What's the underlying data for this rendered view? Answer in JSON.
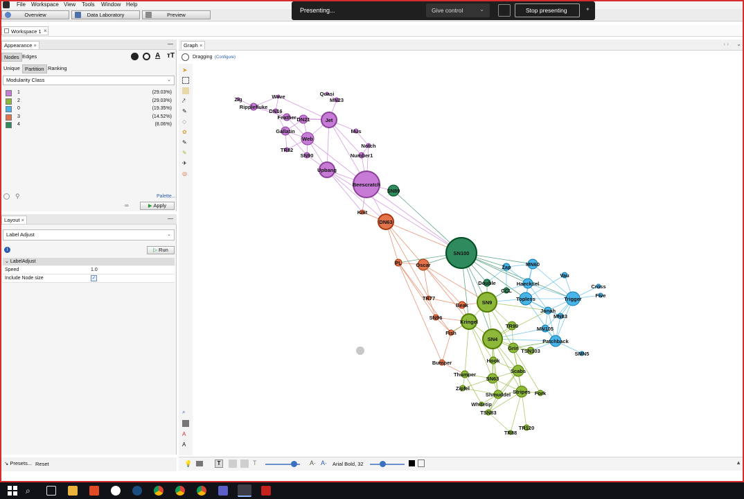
{
  "menubar": {
    "items": [
      "File",
      "Workspace",
      "View",
      "Tools",
      "Window",
      "Help"
    ]
  },
  "modes": {
    "overview": "Overview",
    "data_laboratory": "Data Laboratory",
    "preview": "Preview"
  },
  "presenting": {
    "status": "Presenting...",
    "give_control": "Give control",
    "stop": "Stop presenting"
  },
  "workspace_tab": "Workspace 1",
  "appearance": {
    "title": "Appearance",
    "tabs": [
      "Nodes",
      "Edges"
    ],
    "subtabs": [
      "Unique",
      "Partition",
      "Ranking"
    ],
    "attribute": "Modularity Class",
    "legend": [
      {
        "label": "1",
        "pct": "(29.03%)",
        "color": "#c77bd6"
      },
      {
        "label": "2",
        "pct": "(29.03%)",
        "color": "#8db83a"
      },
      {
        "label": "0",
        "pct": "(19.35%)",
        "color": "#49b4e8"
      },
      {
        "label": "3",
        "pct": "(14.52%)",
        "color": "#e3734a"
      },
      {
        "label": "4",
        "pct": "(8.06%)",
        "color": "#2f8a5e"
      }
    ],
    "palette_link": "Palette...",
    "apply": "Apply"
  },
  "layout": {
    "title": "Layout",
    "algorithm": "Label Adjust",
    "run": "Run",
    "section": "LabelAdjust",
    "props": [
      {
        "name": "Speed",
        "value": "1.0"
      },
      {
        "name": "Include Node size",
        "value": ""
      }
    ],
    "presets": "Presets...",
    "reset": "Reset"
  },
  "graph": {
    "tab": "Graph",
    "mode": "Dragging",
    "configure": "(Configure)",
    "font_label": "Arial Bold, 32"
  },
  "network": {
    "colors": {
      "1": "#c77bd6",
      "2": "#8db83a",
      "0": "#49b4e8",
      "3": "#e3734a",
      "4": "#2f8a5e"
    },
    "nodes": [
      {
        "id": "Zig",
        "g": "1",
        "r": 2
      },
      {
        "id": "Ripplefluke",
        "g": "1",
        "r": 5
      },
      {
        "id": "Wave",
        "g": "1",
        "r": 2
      },
      {
        "id": "DN16",
        "g": "1",
        "r": 3
      },
      {
        "id": "Feather",
        "g": "1",
        "r": 5
      },
      {
        "id": "Quasi",
        "g": "1",
        "r": 2
      },
      {
        "id": "MN23",
        "g": "1",
        "r": 3
      },
      {
        "id": "DN21",
        "g": "1",
        "r": 6
      },
      {
        "id": "Jet",
        "g": "1",
        "r": 11
      },
      {
        "id": "Gallatin",
        "g": "1",
        "r": 6
      },
      {
        "id": "Mus",
        "g": "1",
        "r": 3
      },
      {
        "id": "Web",
        "g": "1",
        "r": 9
      },
      {
        "id": "Notch",
        "g": "1",
        "r": 3
      },
      {
        "id": "TR82",
        "g": "1",
        "r": 3
      },
      {
        "id": "SN90",
        "g": "1",
        "r": 4
      },
      {
        "id": "Number1",
        "g": "1",
        "r": 4
      },
      {
        "id": "Upbang",
        "g": "1",
        "r": 11
      },
      {
        "id": "Beescratch",
        "g": "1",
        "r": 19
      },
      {
        "id": "SN89",
        "g": "4",
        "r": 8
      },
      {
        "id": "Knit",
        "g": "3",
        "r": 3
      },
      {
        "id": "DN63",
        "g": "3",
        "r": 11
      },
      {
        "id": "SN100",
        "g": "4",
        "r": 22
      },
      {
        "id": "PL",
        "g": "3",
        "r": 5
      },
      {
        "id": "Oscar",
        "g": "3",
        "r": 8
      },
      {
        "id": "Zap",
        "g": "0",
        "r": 5
      },
      {
        "id": "MN60",
        "g": "0",
        "r": 7
      },
      {
        "id": "Vau",
        "g": "0",
        "r": 4
      },
      {
        "id": "Double",
        "g": "4",
        "r": 5
      },
      {
        "id": "Haecksel",
        "g": "0",
        "r": 7
      },
      {
        "id": "Cross",
        "g": "0",
        "r": 3
      },
      {
        "id": "CCL",
        "g": "4",
        "r": 4
      },
      {
        "id": "TR77",
        "g": "3",
        "r": 3
      },
      {
        "id": "Topless",
        "g": "0",
        "r": 9
      },
      {
        "id": "Trigger",
        "g": "0",
        "r": 10
      },
      {
        "id": "Five",
        "g": "0",
        "r": 3
      },
      {
        "id": "Beak",
        "g": "3",
        "r": 5
      },
      {
        "id": "SN9",
        "g": "2",
        "r": 14
      },
      {
        "id": "Jonah",
        "g": "0",
        "r": 5
      },
      {
        "id": "MN83",
        "g": "0",
        "r": 4
      },
      {
        "id": "SN96",
        "g": "3",
        "r": 4
      },
      {
        "id": "Kringel",
        "g": "2",
        "r": 11
      },
      {
        "id": "TR99",
        "g": "2",
        "r": 6
      },
      {
        "id": "MN105",
        "g": "0",
        "r": 5
      },
      {
        "id": "Fish",
        "g": "3",
        "r": 4
      },
      {
        "id": "SN4",
        "g": "2",
        "r": 14
      },
      {
        "id": "Patchback",
        "g": "0",
        "r": 8
      },
      {
        "id": "Grin",
        "g": "2",
        "r": 7
      },
      {
        "id": "TSN103",
        "g": "2",
        "r": 5
      },
      {
        "id": "SMN5",
        "g": "0",
        "r": 3
      },
      {
        "id": "Bumper",
        "g": "3",
        "r": 4
      },
      {
        "id": "Hook",
        "g": "2",
        "r": 5
      },
      {
        "id": "Scabs",
        "g": "2",
        "r": 8
      },
      {
        "id": "Thumper",
        "g": "2",
        "r": 5
      },
      {
        "id": "SN63",
        "g": "2",
        "r": 7
      },
      {
        "id": "Zipfel",
        "g": "2",
        "r": 4
      },
      {
        "id": "Shmuddel",
        "g": "2",
        "r": 6
      },
      {
        "id": "Stripes",
        "g": "2",
        "r": 8
      },
      {
        "id": "Fork",
        "g": "2",
        "r": 4
      },
      {
        "id": "Whitetip",
        "g": "2",
        "r": 3
      },
      {
        "id": "TSN83",
        "g": "2",
        "r": 4
      },
      {
        "id": "TR120",
        "g": "2",
        "r": 4
      },
      {
        "id": "TR88",
        "g": "2",
        "r": 3
      }
    ],
    "edges": [
      [
        "Zig",
        "Ripplefluke"
      ],
      [
        "Ripplefluke",
        "DN16"
      ],
      [
        "Ripplefluke",
        "Wave"
      ],
      [
        "Ripplefluke",
        "Feather"
      ],
      [
        "Wave",
        "DN16"
      ],
      [
        "Wave",
        "Jet"
      ],
      [
        "DN16",
        "Gallatin"
      ],
      [
        "DN16",
        "Feather"
      ],
      [
        "Feather",
        "DN21"
      ],
      [
        "Feather",
        "Web"
      ],
      [
        "Feather",
        "Jet"
      ],
      [
        "Quasi",
        "MN23"
      ],
      [
        "MN23",
        "Jet"
      ],
      [
        "DN21",
        "Jet"
      ],
      [
        "DN21",
        "Web"
      ],
      [
        "DN21",
        "Gallatin"
      ],
      [
        "Jet",
        "Web"
      ],
      [
        "Jet",
        "Mus"
      ],
      [
        "Jet",
        "Beescratch"
      ],
      [
        "Jet",
        "Number1"
      ],
      [
        "Jet",
        "Upbang"
      ],
      [
        "Gallatin",
        "Web"
      ],
      [
        "Gallatin",
        "SN90"
      ],
      [
        "Gallatin",
        "TR82"
      ],
      [
        "Mus",
        "Notch"
      ],
      [
        "Notch",
        "Number1"
      ],
      [
        "Notch",
        "Beescratch"
      ],
      [
        "Web",
        "SN90"
      ],
      [
        "Web",
        "Upbang"
      ],
      [
        "Web",
        "Beescratch"
      ],
      [
        "Web",
        "TR82"
      ],
      [
        "SN90",
        "Upbang"
      ],
      [
        "Number1",
        "Beescratch"
      ],
      [
        "Upbang",
        "Beescratch"
      ],
      [
        "Upbang",
        "DN63"
      ],
      [
        "Upbang",
        "Knit"
      ],
      [
        "Upbang",
        "SN100"
      ],
      [
        "Beescratch",
        "SN89"
      ],
      [
        "Beescratch",
        "DN63"
      ],
      [
        "Beescratch",
        "SN100"
      ],
      [
        "Beescratch",
        "Knit"
      ],
      [
        "Knit",
        "DN63"
      ],
      [
        "SN89",
        "SN100"
      ],
      [
        "DN63",
        "PL"
      ],
      [
        "DN63",
        "Oscar"
      ],
      [
        "DN63",
        "SN100"
      ],
      [
        "DN63",
        "TR77"
      ],
      [
        "SN100",
        "Oscar"
      ],
      [
        "SN100",
        "PL"
      ],
      [
        "SN100",
        "Zap"
      ],
      [
        "SN100",
        "MN60"
      ],
      [
        "SN100",
        "Double"
      ],
      [
        "SN100",
        "SN9"
      ],
      [
        "SN100",
        "Topless"
      ],
      [
        "SN100",
        "Trigger"
      ],
      [
        "SN100",
        "SN4"
      ],
      [
        "SN100",
        "Kringel"
      ],
      [
        "SN100",
        "Haecksel"
      ],
      [
        "PL",
        "Oscar"
      ],
      [
        "PL",
        "SN96"
      ],
      [
        "PL",
        "Bumper"
      ],
      [
        "PL",
        "Fish"
      ],
      [
        "Oscar",
        "Beak"
      ],
      [
        "Oscar",
        "SN9"
      ],
      [
        "Oscar",
        "Kringel"
      ],
      [
        "Oscar",
        "TR77"
      ],
      [
        "TR77",
        "SN96"
      ],
      [
        "TR77",
        "Beak"
      ],
      [
        "Beak",
        "Kringel"
      ],
      [
        "Beak",
        "SN9"
      ],
      [
        "SN96",
        "Kringel"
      ],
      [
        "SN96",
        "Fish"
      ],
      [
        "Fish",
        "Bumper"
      ],
      [
        "Fish",
        "Kringel"
      ],
      [
        "Zap",
        "MN60"
      ],
      [
        "Zap",
        "Haecksel"
      ],
      [
        "Zap",
        "Double"
      ],
      [
        "Zap",
        "CCL"
      ],
      [
        "MN60",
        "Haecksel"
      ],
      [
        "MN60",
        "Topless"
      ],
      [
        "MN60",
        "Trigger"
      ],
      [
        "Vau",
        "Topless"
      ],
      [
        "Vau",
        "Trigger"
      ],
      [
        "Haecksel",
        "Topless"
      ],
      [
        "Haecksel",
        "Trigger"
      ],
      [
        "Haecksel",
        "Jonah"
      ],
      [
        "Haecksel",
        "CCL"
      ],
      [
        "Cross",
        "Trigger"
      ],
      [
        "Five",
        "Trigger"
      ],
      [
        "Topless",
        "Trigger"
      ],
      [
        "Topless",
        "Jonah"
      ],
      [
        "Topless",
        "MN83"
      ],
      [
        "Topless",
        "SN9"
      ],
      [
        "Topless",
        "Patchback"
      ],
      [
        "Trigger",
        "Jonah"
      ],
      [
        "Trigger",
        "MN83"
      ],
      [
        "Trigger",
        "Patchback"
      ],
      [
        "Trigger",
        "MN105"
      ],
      [
        "Jonah",
        "MN83"
      ],
      [
        "Jonah",
        "Patchback"
      ],
      [
        "Jonah",
        "MN105"
      ],
      [
        "MN83",
        "Patchback"
      ],
      [
        "MN105",
        "Patchback"
      ],
      [
        "MN105",
        "SN4"
      ],
      [
        "Patchback",
        "SMN5"
      ],
      [
        "Patchback",
        "SN4"
      ],
      [
        "Patchback",
        "TSN103"
      ],
      [
        "Patchback",
        "Grin"
      ],
      [
        "Double",
        "SN9"
      ],
      [
        "CCL",
        "SN9"
      ],
      [
        "SN9",
        "Kringel"
      ],
      [
        "SN9",
        "SN4"
      ],
      [
        "SN9",
        "TR99"
      ],
      [
        "SN9",
        "Grin"
      ],
      [
        "SN9",
        "Jonah"
      ],
      [
        "Kringel",
        "SN4"
      ],
      [
        "Kringel",
        "Thumper"
      ],
      [
        "Kringel",
        "Hook"
      ],
      [
        "Kringel",
        "SN63"
      ],
      [
        "Kringel",
        "Fish"
      ],
      [
        "TR99",
        "SN4"
      ],
      [
        "TR99",
        "Grin"
      ],
      [
        "SN4",
        "Grin"
      ],
      [
        "SN4",
        "Hook"
      ],
      [
        "SN4",
        "Scabs"
      ],
      [
        "SN4",
        "SN63"
      ],
      [
        "SN4",
        "Stripes"
      ],
      [
        "SN4",
        "TSN103"
      ],
      [
        "SN4",
        "Shmuddel"
      ],
      [
        "Grin",
        "Scabs"
      ],
      [
        "Grin",
        "TSN103"
      ],
      [
        "Grin",
        "Stripes"
      ],
      [
        "Grin",
        "Fork"
      ],
      [
        "Hook",
        "Scabs"
      ],
      [
        "Hook",
        "SN63"
      ],
      [
        "Hook",
        "Shmuddel"
      ],
      [
        "Scabs",
        "Stripes"
      ],
      [
        "Scabs",
        "SN63"
      ],
      [
        "Scabs",
        "Shmuddel"
      ],
      [
        "Scabs",
        "TSN83"
      ],
      [
        "Thumper",
        "SN63"
      ],
      [
        "Thumper",
        "Zipfel"
      ],
      [
        "Thumper",
        "Whitetip"
      ],
      [
        "SN63",
        "Zipfel"
      ],
      [
        "SN63",
        "Shmuddel"
      ],
      [
        "SN63",
        "Stripes"
      ],
      [
        "Zipfel",
        "Shmuddel"
      ],
      [
        "Shmuddel",
        "Stripes"
      ],
      [
        "Shmuddel",
        "Whitetip"
      ],
      [
        "Shmuddel",
        "TSN83"
      ],
      [
        "Stripes",
        "Fork"
      ],
      [
        "Stripes",
        "TR120"
      ],
      [
        "Stripes",
        "TR88"
      ],
      [
        "Stripes",
        "TSN83"
      ],
      [
        "Bumper",
        "Thumper"
      ],
      [
        "TR88",
        "TSN83"
      ],
      [
        "Grin",
        "Patchback"
      ],
      [
        "SN4",
        "Jonah"
      ]
    ]
  }
}
